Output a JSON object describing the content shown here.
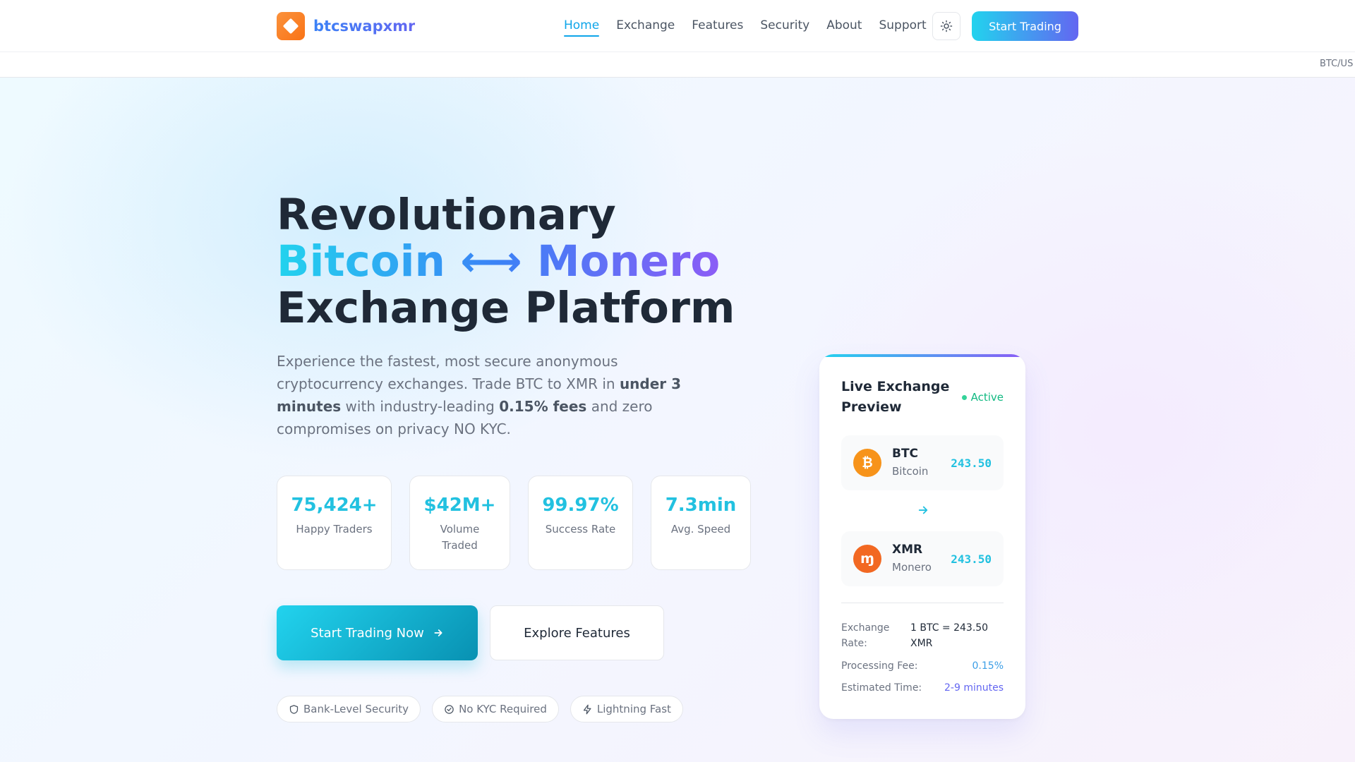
{
  "nav": {
    "brand": "btcswapxmr",
    "links": [
      "Home",
      "Exchange",
      "Features",
      "Security",
      "About",
      "Support"
    ],
    "active_link": "Home",
    "cta": "Start Trading"
  },
  "ticker": {
    "item": "BTC/US"
  },
  "hero": {
    "headline": {
      "line1": "Revolutionary",
      "line2": "Bitcoin ⟷ Monero",
      "line3": "Exchange Platform"
    },
    "subtext": {
      "p1": "Experience the fastest, most secure anonymous cryptocurrency exchanges. Trade BTC to XMR in ",
      "b1": "under 3 minutes",
      "p2": " with industry-leading ",
      "b2": "0.15% fees",
      "p3": " and zero compromises on privacy NO KYC."
    },
    "stats": [
      {
        "value": "75,424+",
        "label": "Happy Traders"
      },
      {
        "value": "$42M+",
        "label": "Volume Traded"
      },
      {
        "value": "99.97%",
        "label": "Success Rate"
      },
      {
        "value": "7.3min",
        "label": "Avg. Speed"
      }
    ],
    "primary_button": "Start Trading Now",
    "secondary_button": "Explore Features",
    "badges": [
      "Bank-Level Security",
      "No KYC Required",
      "Lightning Fast"
    ]
  },
  "card": {
    "title": "Live Exchange Preview",
    "status": "Active",
    "from": {
      "symbol": "BTC",
      "name": "Bitcoin",
      "amount": "243.50",
      "glyph": "₿"
    },
    "to": {
      "symbol": "XMR",
      "name": "Monero",
      "amount": "243.50",
      "glyph": "ɱ"
    },
    "details": {
      "rate_label": "Exchange Rate:",
      "rate_value": "1 BTC = 243.50 XMR",
      "fee_label": "Processing Fee:",
      "fee_value": "0.15%",
      "time_label": "Estimated Time:",
      "time_value": "2-9 minutes"
    }
  },
  "colors": {
    "accent": "#22d3ee",
    "accent_secondary": "#6366f1",
    "btc": "#f7931a",
    "xmr": "#f26822",
    "active": "#10b981"
  }
}
